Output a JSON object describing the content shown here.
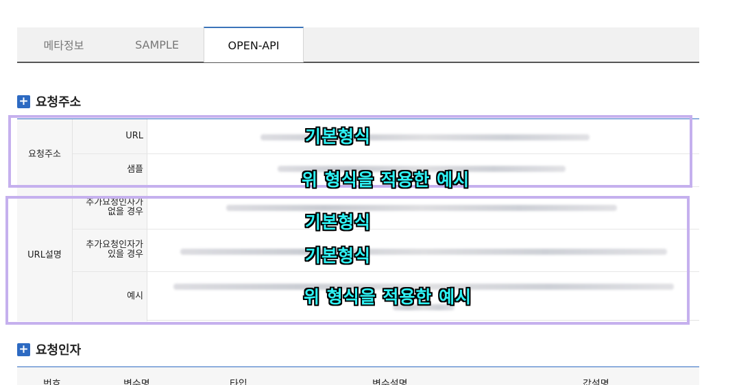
{
  "tabs": [
    {
      "label": "메타정보"
    },
    {
      "label": "SAMPLE"
    },
    {
      "label": "OPEN-API"
    }
  ],
  "request_address": {
    "title": "요청주소",
    "group": "요청주소",
    "rows": [
      {
        "label": "URL"
      },
      {
        "label": "샘플"
      }
    ]
  },
  "url_desc": {
    "group": "URL설명",
    "rows": [
      {
        "label_line1": "추가요청인자가",
        "label_line2": "없을 경우"
      },
      {
        "label_line1": "추가요청인자가",
        "label_line2": "있을 경우"
      },
      {
        "label_line1": "예시",
        "label_line2": ""
      }
    ]
  },
  "annotations": [
    "기본형식",
    "위 형식을 적용한 예시",
    "기본형식",
    "기본형식",
    "위 형식을 적용한 예시"
  ],
  "request_params": {
    "title": "요청인자",
    "columns": [
      "번호",
      "변수명",
      "타입",
      "변수설명",
      "값설명"
    ]
  },
  "colors": {
    "accent": "#2d6ac2",
    "annotation_box": "#c5b0ee",
    "annotation_text": "#2ff3f5"
  }
}
